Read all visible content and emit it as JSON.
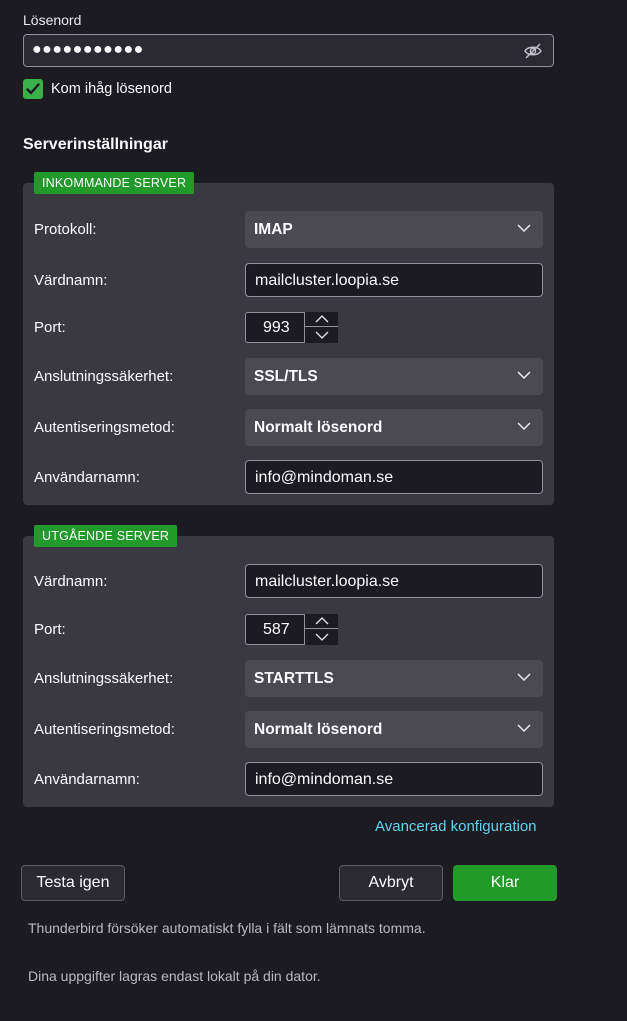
{
  "password": {
    "label": "Lösenord",
    "value_masked": "●●●●●●●●●●●",
    "toggle_icon": "eye-slash-icon"
  },
  "remember": {
    "label": "Kom ihåg lösenord",
    "checked": true
  },
  "section_title": "Serverinställningar",
  "incoming": {
    "badge": "INKOMMANDE SERVER",
    "protocol_label": "Protokoll:",
    "protocol_value": "IMAP",
    "hostname_label": "Värdnamn:",
    "hostname_value": "mailcluster.loopia.se",
    "port_label": "Port:",
    "port_value": "993",
    "security_label": "Anslutningssäkerhet:",
    "security_value": "SSL/TLS",
    "auth_label": "Autentiseringsmetod:",
    "auth_value": "Normalt lösenord",
    "username_label": "Användarnamn:",
    "username_value": "info@mindoman.se"
  },
  "outgoing": {
    "badge": "UTGÅENDE SERVER",
    "hostname_label": "Värdnamn:",
    "hostname_value": "mailcluster.loopia.se",
    "port_label": "Port:",
    "port_value": "587",
    "security_label": "Anslutningssäkerhet:",
    "security_value": "STARTTLS",
    "auth_label": "Autentiseringsmetod:",
    "auth_value": "Normalt lösenord",
    "username_label": "Användarnamn:",
    "username_value": "info@mindoman.se"
  },
  "advanced_link": "Avancerad konfiguration",
  "buttons": {
    "retest": "Testa igen",
    "cancel": "Avbryt",
    "done": "Klar"
  },
  "notes": {
    "autofill": "Thunderbird försöker automatiskt fylla i fält som lämnats tomma.",
    "privacy": "Dina uppgifter lagras endast lokalt på din dator."
  },
  "colors": {
    "accent": "#22992b",
    "link": "#5ed4f2",
    "background": "#1c1b22",
    "panel": "#3a3941"
  }
}
